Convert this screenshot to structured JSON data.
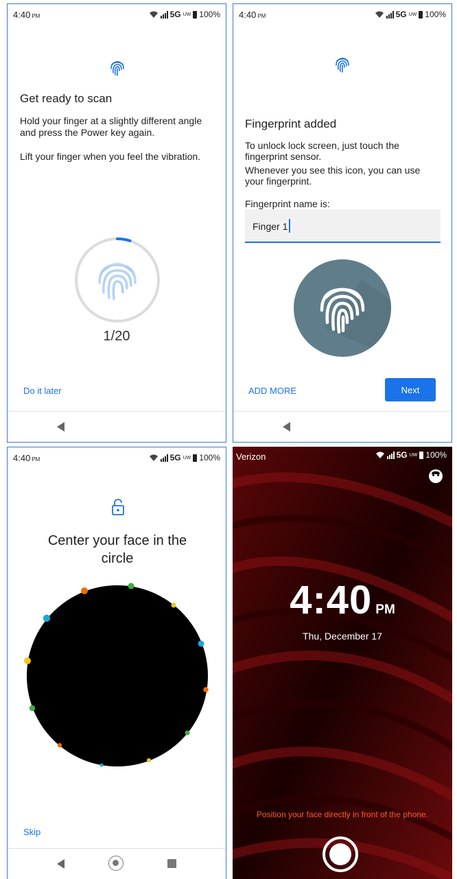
{
  "status_bar": {
    "time": "4:40",
    "ampm": "PM",
    "network": "5G",
    "uw": "UW",
    "battery": "100%"
  },
  "scan_screen": {
    "title": "Get ready to scan",
    "instruction_1": "Hold your finger at a slightly different angle and press the Power key again.",
    "instruction_2": "Lift your finger when you feel the vibration.",
    "progress_text": "1/20",
    "progress_fraction": 0.05,
    "do_it_later": "Do it later"
  },
  "added_screen": {
    "title": "Fingerprint added",
    "description_1": "To unlock lock screen, just touch the fingerprint sensor.",
    "description_2": "Whenever you see this icon, you can use your fingerprint.",
    "name_label": "Fingerprint name is:",
    "name_value": "Finger 1",
    "add_more": "ADD MORE",
    "next": "Next",
    "accent_color": "#1a73e8"
  },
  "face_screen": {
    "title": "Center your face in the circle",
    "skip": "Skip"
  },
  "lock_screen": {
    "carrier": "Verizon",
    "time": "4:40",
    "ampm": "PM",
    "date": "Thu, December 17",
    "hint": "Position your face directly in front of the phone.",
    "hint_color": "#ff5a2d"
  }
}
